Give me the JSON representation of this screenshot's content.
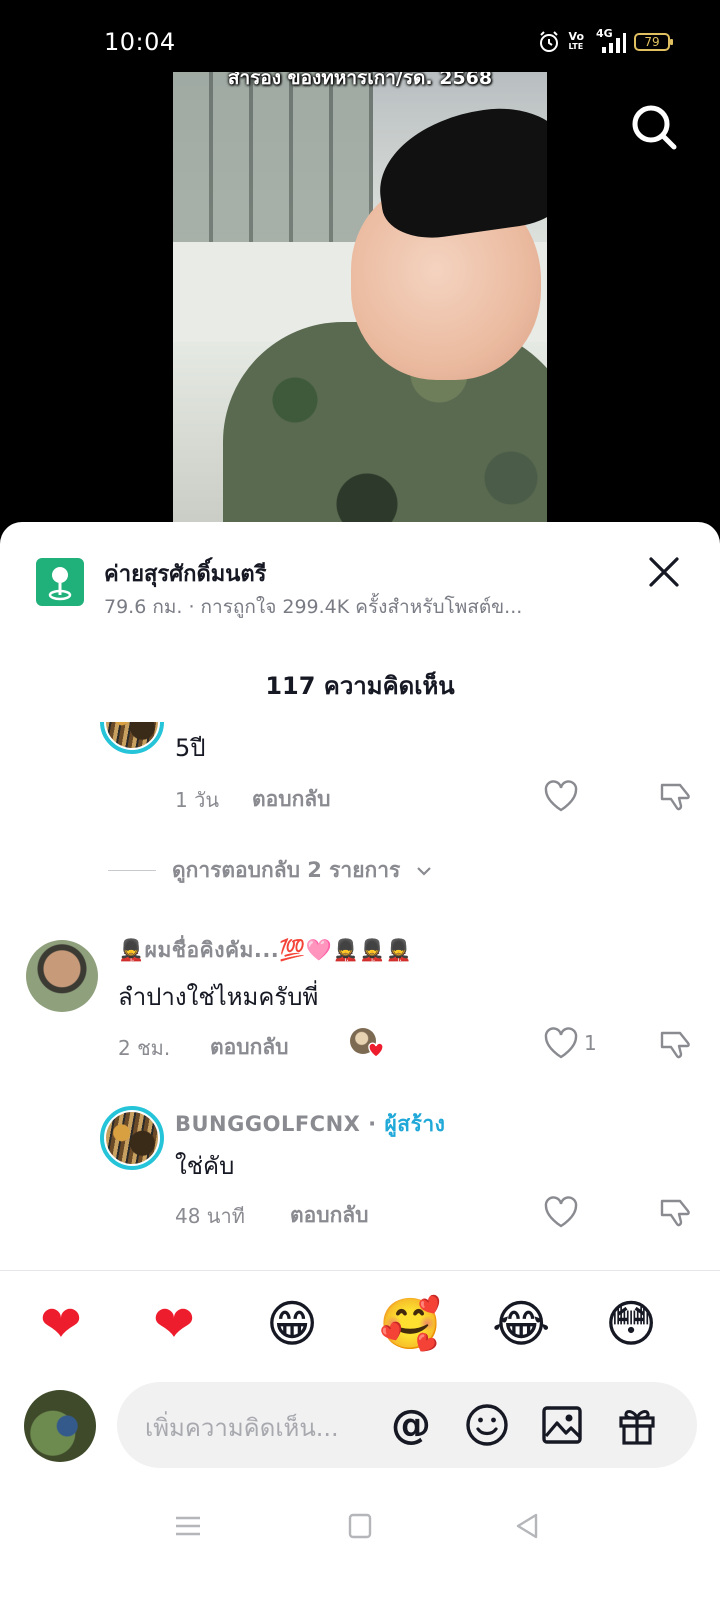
{
  "status": {
    "time": "10:04",
    "volte_top": "Vo",
    "volte_bottom": "LTE",
    "network": "4G",
    "battery": "79"
  },
  "video": {
    "caption": "สำรอง ของทหารเก่า/รด. 2568"
  },
  "place": {
    "name": "ค่ายสุรศักดิ์มนตรี",
    "meta": "79.6 กม. · การถูกใจ 299.4K ครั้งสำหรับโพสต์ข..."
  },
  "comments_header": {
    "title": "117 ความคิดเห็น"
  },
  "comments": [
    {
      "text": "5ปี",
      "time": "1 วัน",
      "reply_label": "ตอบกลับ"
    },
    {
      "view_replies": "ดูการตอบกลับ 2 รายการ",
      "username": "💂ผมชื่อคิงคัม...💯🩷💂💂💂",
      "text": "ลำปางใช่ไหมครับพี่",
      "time": "2 ชม.",
      "reply_label": "ตอบกลับ",
      "like_count": "1"
    },
    {
      "username": "BUNGGOLFCNX",
      "separator": " · ",
      "creator_tag": "ผู้สร้าง",
      "text": "ใช่คับ",
      "time": "48 นาที",
      "reply_label": "ตอบกลับ"
    }
  ],
  "quick_emojis": [
    "❤",
    "❤",
    "😁",
    "🥰",
    "😂",
    "😳"
  ],
  "input": {
    "placeholder": "เพิ่มความคิดเห็น...",
    "mention_symbol": "@"
  },
  "colors": {
    "accent_teal": "#25c4d9",
    "creator_blue": "#1fa8d8",
    "place_green": "#20b07a",
    "heart_red": "#ee1d2d"
  },
  "icons": [
    "search-icon",
    "location-pin-icon",
    "close-icon",
    "heart-icon",
    "dislike-icon",
    "mention-icon",
    "emoji-icon",
    "image-icon",
    "gift-icon",
    "menu-icon",
    "home-square-icon",
    "back-triangle-icon"
  ]
}
